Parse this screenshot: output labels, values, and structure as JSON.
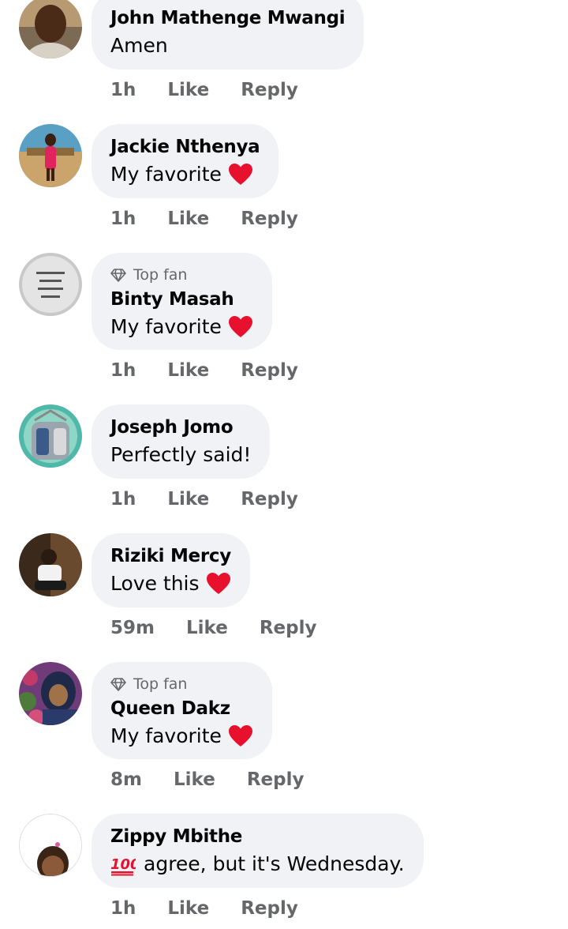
{
  "comments": [
    {
      "name": "John Mathenge Mwangi",
      "text": "Amen",
      "time": "1h",
      "like": "Like",
      "reply": "Reply",
      "top_fan": false,
      "heart": false,
      "avatar": "man"
    },
    {
      "name": "Jackie Nthenya",
      "text": "My favorite",
      "time": "1h",
      "like": "Like",
      "reply": "Reply",
      "top_fan": false,
      "heart": true,
      "avatar": "woman-pink"
    },
    {
      "name": "Binty Masah",
      "text": "My favorite",
      "time": "1h",
      "like": "Like",
      "reply": "Reply",
      "top_fan": true,
      "badge": "Top fan",
      "heart": true,
      "avatar": "silver-plate"
    },
    {
      "name": "Joseph Jomo",
      "text": "Perfectly said!",
      "time": "1h",
      "like": "Like",
      "reply": "Reply",
      "top_fan": false,
      "heart": false,
      "avatar": "tag"
    },
    {
      "name": "Riziki Mercy",
      "text": "Love this",
      "time": "59m",
      "like": "Like",
      "reply": "Reply",
      "top_fan": false,
      "heart": true,
      "avatar": "woman-dark"
    },
    {
      "name": "Queen Dakz",
      "text": "My favorite",
      "time": "8m",
      "like": "Like",
      "reply": "Reply",
      "top_fan": true,
      "badge": "Top fan",
      "heart": true,
      "avatar": "woman-hijab"
    },
    {
      "name": "Zippy Mbithe",
      "text": "agree, but it's Wednesday.",
      "time": "1h",
      "like": "Like",
      "reply": "Reply",
      "top_fan": false,
      "heart": false,
      "prefix_icon": "hundred-points-icon",
      "avatar": "child"
    }
  ],
  "colors": {
    "bubble": "#f0f2f5",
    "meta_text": "#65676b",
    "name_text": "#050505",
    "heart": "#e8112d"
  }
}
